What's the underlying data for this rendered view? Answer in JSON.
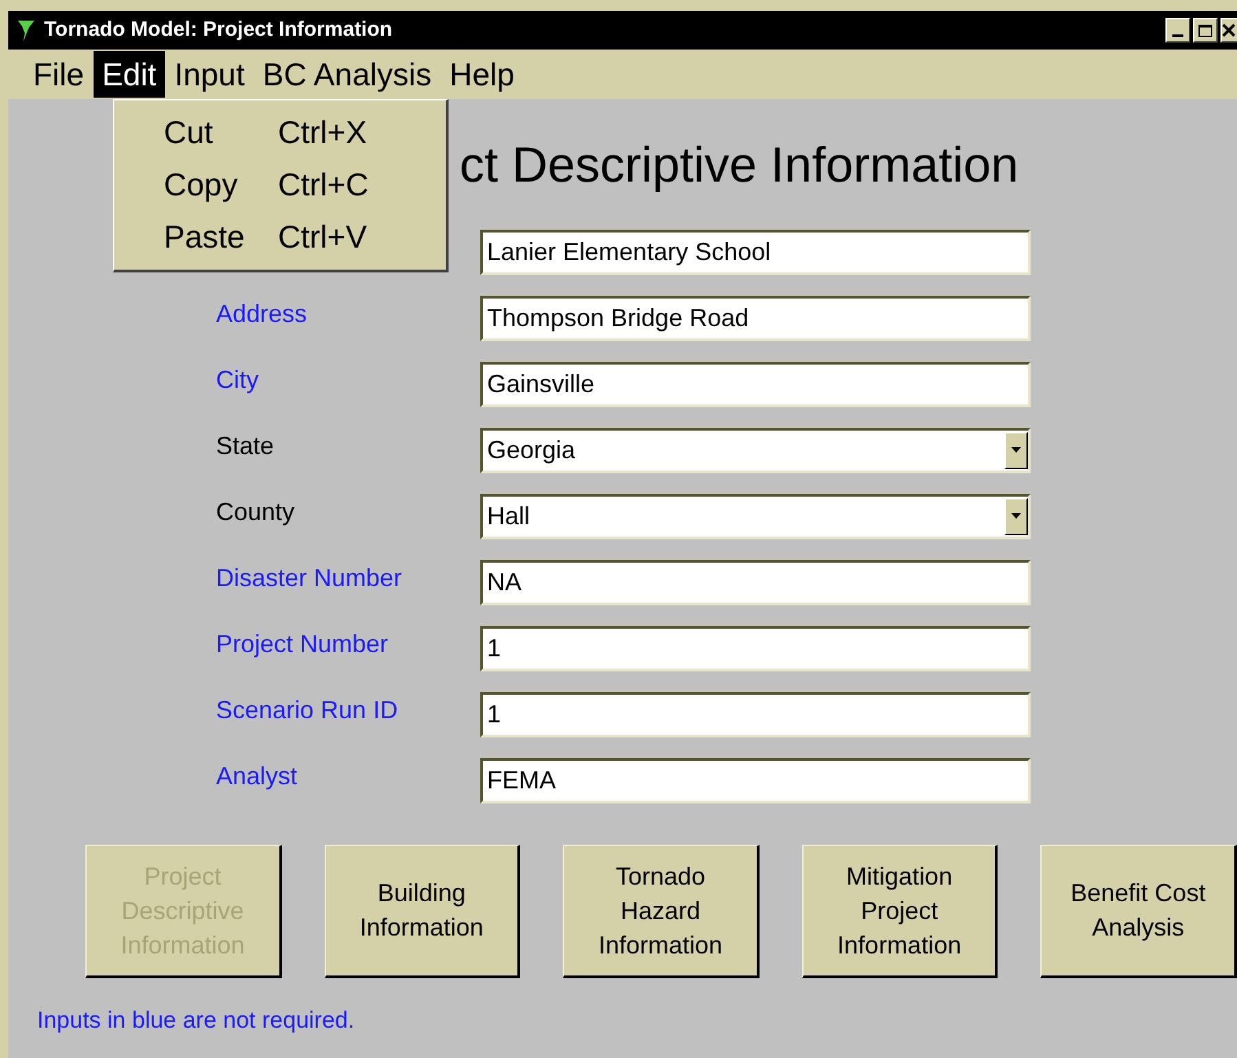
{
  "window": {
    "title": "Tornado Model: Project Information"
  },
  "menu_bar": [
    {
      "label": "File",
      "selected": false
    },
    {
      "label": "Edit",
      "selected": true
    },
    {
      "label": "Input",
      "selected": false
    },
    {
      "label": "BC Analysis",
      "selected": false
    },
    {
      "label": "Help",
      "selected": false
    }
  ],
  "edit_menu": [
    {
      "label": "Cut",
      "shortcut": "Ctrl+X"
    },
    {
      "label": "Copy",
      "shortcut": "Ctrl+C"
    },
    {
      "label": "Paste",
      "shortcut": "Ctrl+V"
    }
  ],
  "heading": "ct Descriptive Information",
  "fields": [
    {
      "kind": "text",
      "value": "Lanier Elementary School"
    },
    {
      "label": "Address",
      "required": false,
      "kind": "text",
      "value": "Thompson Bridge Road"
    },
    {
      "label": "City",
      "required": false,
      "kind": "text",
      "value": "Gainsville"
    },
    {
      "label": "State",
      "required": true,
      "kind": "dropdown",
      "value": "Georgia"
    },
    {
      "label": "County",
      "required": true,
      "kind": "dropdown",
      "value": "Hall"
    },
    {
      "label": "Disaster Number",
      "required": false,
      "kind": "text",
      "value": "NA"
    },
    {
      "label": "Project Number",
      "required": false,
      "kind": "text",
      "value": "1"
    },
    {
      "label": "Scenario Run ID",
      "required": false,
      "kind": "text",
      "value": "1"
    },
    {
      "label": "Analyst",
      "required": false,
      "kind": "text",
      "value": "FEMA"
    }
  ],
  "nav_buttons": [
    {
      "label": "Project Descriptive Information",
      "disabled": true
    },
    {
      "label": "Building Information",
      "disabled": false
    },
    {
      "label": "Tornado Hazard Information",
      "disabled": false
    },
    {
      "label": "Mitigation Project Information",
      "disabled": false
    },
    {
      "label": "Benefit Cost Analysis",
      "disabled": false
    }
  ],
  "footer_note": "Inputs in blue are not required."
}
